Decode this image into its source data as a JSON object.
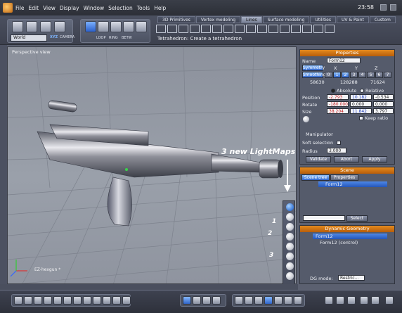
{
  "app": {
    "clock": "23:58"
  },
  "menu": [
    "File",
    "Edit",
    "View",
    "Display",
    "Window",
    "Selection",
    "Tools",
    "Help"
  ],
  "toolbar": {
    "world_select": "World",
    "xyz_label": "XYZ",
    "camera_label": "CAMERA",
    "mode_labels": [
      "LOOP",
      "RING",
      "BETW"
    ]
  },
  "tabs": [
    {
      "label": "3D Primitives",
      "active": false
    },
    {
      "label": "Vertex modeling",
      "active": false
    },
    {
      "label": "Lines",
      "active": true
    },
    {
      "label": "Surface modeling",
      "active": false
    },
    {
      "label": "Utilities",
      "active": false
    },
    {
      "label": "UV & Paint",
      "active": false
    },
    {
      "label": "Custom",
      "active": false
    }
  ],
  "status": "Tetrahedron: Create a tetrahedron",
  "viewport": {
    "title": "Perspective view",
    "camera_label": "EZ-hexgun *",
    "annotation_main": "3 new LightMaps",
    "annotation_numbers": [
      "1",
      "2",
      "3"
    ]
  },
  "properties": {
    "title": "Properties",
    "name_label": "Name",
    "name_value": "Form12",
    "symmetry_label": "Symmetry",
    "axes": [
      "X",
      "Y",
      "Z"
    ],
    "smoothing_label": "Smoothing",
    "smoothing_levels": [
      "0",
      "1",
      "2",
      "3",
      "4",
      "5",
      "6",
      "7"
    ],
    "counts": [
      "58630",
      "128288",
      "71624"
    ],
    "absolute_label": "Absolute",
    "relative_label": "Relative",
    "position_label": "Position",
    "position": [
      "-2.793",
      "10.182",
      "-0.534"
    ],
    "rotate_label": "Rotate",
    "rotate": [
      "-180.000",
      "0.000",
      "0.000"
    ],
    "size_label": "Size",
    "size": [
      "38.204",
      "11.842",
      "3.797"
    ],
    "keep_ratio_label": "Keep ratio",
    "manipulator_label": "Manipulator",
    "soft_selection_label": "Soft selection",
    "radius_label": "Radius",
    "radius_value": "3.000",
    "validate_label": "Validate",
    "abort_label": "Abort",
    "apply_label": "Apply"
  },
  "scene": {
    "title": "Scene",
    "tabs": [
      "Scene tree",
      "Properties"
    ],
    "item": "Form12",
    "select_label": "Select"
  },
  "dynamic": {
    "title": "Dynamic Geometry",
    "items": [
      "Form12",
      "Form12 (control)"
    ],
    "mode_label": "DG mode:",
    "mode_value": "Restric..."
  },
  "colors": {
    "accent_orange": "#e48a1e",
    "selection_blue": "#2e63c9"
  }
}
